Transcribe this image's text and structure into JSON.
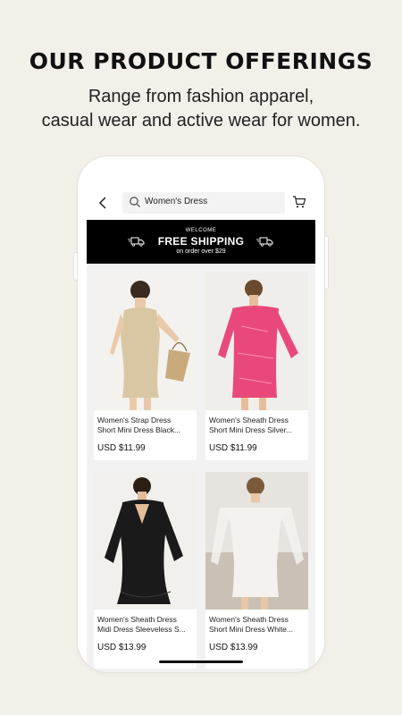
{
  "promo": {
    "headline": "OUR PRODUCT OFFERINGS",
    "subline_1": "Range from fashion apparel,",
    "subline_2": "casual wear and active wear for women."
  },
  "header": {
    "back_icon": "chevron-left-icon",
    "search_icon": "search-icon",
    "search_value": "Women's Dress",
    "cart_icon": "cart-icon"
  },
  "banner": {
    "welcome": "WELCOME",
    "title": "FREE SHIPPING",
    "subtitle": "on order over $29",
    "icon": "truck-icon"
  },
  "products": [
    {
      "line1": "Women's Strap Dress",
      "line2": "Short Mini Dress Black...",
      "price": "USD $11.99",
      "color": "#d9c7a3"
    },
    {
      "line1": "Women's Sheath Dress",
      "line2": "Short Mini Dress Silver...",
      "price": "USD $11.99",
      "color": "#e8497a"
    },
    {
      "line1": "Women's Sheath Dress",
      "line2": "Midi Dress Sleeveless S...",
      "price": "USD $13.99",
      "color": "#1a1a1a"
    },
    {
      "line1": "Women's Sheath Dress",
      "line2": "Short Mini Dress White...",
      "price": "USD $13.99",
      "color": "#f4f1ee"
    }
  ]
}
